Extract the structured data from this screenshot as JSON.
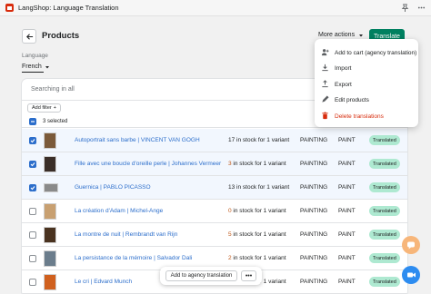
{
  "app": {
    "title": "LangShop: Language Translation",
    "icons": [
      "pin-icon",
      "more-icon"
    ]
  },
  "header": {
    "title": "Products",
    "more_actions_label": "More actions",
    "translate_label": "Translate"
  },
  "language": {
    "label": "Language",
    "selected": "French"
  },
  "list": {
    "search_placeholder": "Searching in all",
    "add_filter_label": "Add filter",
    "selected_count_label": "3 selected",
    "rows": [
      {
        "name": "Autoportrait sans barbe | VINCENT VAN GOGH",
        "stock_qty": "17",
        "stock_text": " in stock for 1 variant",
        "low": false,
        "type": "PAINTING",
        "vendor": "PAINT",
        "status": "Translated",
        "selected": true,
        "thumb_color": "#7b5a3a"
      },
      {
        "name": "Fille avec une boucle d'oreille perle | Johannes Vermeer",
        "stock_qty": "3",
        "stock_text": " in stock for 1 variant",
        "low": true,
        "type": "PAINTING",
        "vendor": "PAINT",
        "status": "Translated",
        "selected": true,
        "thumb_color": "#3a2e28"
      },
      {
        "name": "Guernica | PABLO PICASSO",
        "stock_qty": "13",
        "stock_text": " in stock for 1 variant",
        "low": false,
        "type": "PAINTING",
        "vendor": "PAINT",
        "status": "Translated",
        "selected": true,
        "thumb_color": "#8a8a8a"
      },
      {
        "name": "La création d'Adam | Michel-Ange",
        "stock_qty": "0",
        "stock_text": " in stock for 1 variant",
        "low": true,
        "type": "PAINTING",
        "vendor": "PAINT",
        "status": "Translated",
        "selected": false,
        "thumb_color": "#c8a071"
      },
      {
        "name": "La montre de nuit | Rembrandt van Rijn",
        "stock_qty": "5",
        "stock_text": " in stock for 1 variant",
        "low": true,
        "type": "PAINTING",
        "vendor": "PAINT",
        "status": "Translated",
        "selected": false,
        "thumb_color": "#4a3320"
      },
      {
        "name": "La persistance de la mémoire | Salvador Dali",
        "stock_qty": "2",
        "stock_text": " in stock for 1 variant",
        "low": true,
        "type": "PAINTING",
        "vendor": "PAINT",
        "status": "Translated",
        "selected": false,
        "thumb_color": "#6b7d8c"
      },
      {
        "name": "Le cri | Edvard Munch",
        "stock_qty": "0",
        "stock_text": " in stock for 1 variant",
        "low": true,
        "type": "PAINTING",
        "vendor": "PAINT",
        "status": "Translated",
        "selected": false,
        "thumb_color": "#d0601e"
      }
    ]
  },
  "menu": {
    "items": [
      {
        "label": "Add to cart (agency translation)",
        "icon": "person-add-icon",
        "danger": false
      },
      {
        "label": "Import",
        "icon": "import-icon",
        "danger": false
      },
      {
        "label": "Export",
        "icon": "export-icon",
        "danger": false
      },
      {
        "label": "Edit products",
        "icon": "edit-icon",
        "danger": false
      },
      {
        "label": "Delete translations",
        "icon": "delete-icon",
        "danger": true
      }
    ]
  },
  "bulk_actions": {
    "primary_label": "Add to agency translation",
    "more_label": "•••"
  },
  "colors": {
    "primary": "#008060",
    "link": "#2c6ecb",
    "badge": "#aee9d1",
    "danger": "#d72c0d",
    "low_stock": "#c05717",
    "chat_fab": "#f7b67a",
    "call_fab": "#2d8cf0"
  }
}
